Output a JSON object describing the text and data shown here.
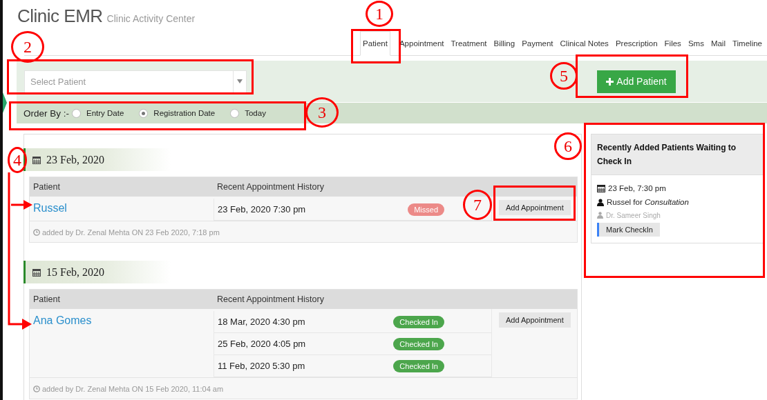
{
  "header": {
    "title": "Clinic EMR",
    "subtitle": "Clinic Activity Center"
  },
  "tabs": [
    {
      "label": "Patient",
      "selected": true
    },
    {
      "label": "Appointment",
      "selected": false
    },
    {
      "label": "Treatment",
      "selected": false
    },
    {
      "label": "Billing",
      "selected": false
    },
    {
      "label": "Payment",
      "selected": false
    },
    {
      "label": "Clinical Notes",
      "selected": false
    },
    {
      "label": "Prescription",
      "selected": false
    },
    {
      "label": "Files",
      "selected": false
    },
    {
      "label": "Sms",
      "selected": false
    },
    {
      "label": "Mail",
      "selected": false
    },
    {
      "label": "Timeline",
      "selected": false
    }
  ],
  "patient_select": {
    "placeholder": "Select Patient"
  },
  "add_patient_button": {
    "label": "Add Patient"
  },
  "order_by": {
    "label": "Order By :-",
    "options": [
      {
        "label": "Entry Date",
        "selected": false
      },
      {
        "label": "Registration Date",
        "selected": true
      },
      {
        "label": "Today",
        "selected": false
      }
    ]
  },
  "groups": [
    {
      "date": "23 Feb, 2020",
      "columns": [
        "Patient",
        "Recent Appointment History"
      ],
      "patient": "Russel",
      "appointments": [
        {
          "time": "23 Feb, 2020 7:30 pm",
          "status": "Missed",
          "kind": "missed"
        }
      ],
      "action": "Add Appointment",
      "added_by": "added by Dr. Zenal Mehta ON 23 Feb 2020, 7:18 pm"
    },
    {
      "date": "15 Feb, 2020",
      "columns": [
        "Patient",
        "Recent Appointment History"
      ],
      "patient": "Ana Gomes",
      "appointments": [
        {
          "time": "18 Mar, 2020 4:30 pm",
          "status": "Checked In",
          "kind": "checked_in"
        },
        {
          "time": "25 Feb, 2020 4:05 pm",
          "status": "Checked In",
          "kind": "checked_in"
        },
        {
          "time": "11 Feb, 2020 5:30 pm",
          "status": "Checked In",
          "kind": "checked_in"
        }
      ],
      "action": "Add Appointment",
      "added_by": "added by Dr. Zenal Mehta ON 15 Feb 2020, 11:04 am"
    }
  ],
  "waiting_panel": {
    "title": "Recently Added Patients Waiting to Check In",
    "entries": [
      {
        "time": "23 Feb, 7:30 pm",
        "visit": "Russel for *Consultation*",
        "doctor": "Dr. Sameer Singh",
        "action": "Mark CheckIn"
      }
    ]
  },
  "annotations": [
    {
      "number": "1",
      "kind": "box"
    },
    {
      "number": "2",
      "kind": "box"
    },
    {
      "number": "3",
      "kind": "box"
    },
    {
      "number": "4",
      "kind": "arrows"
    },
    {
      "number": "5",
      "kind": "box"
    },
    {
      "number": "6",
      "kind": "box"
    },
    {
      "number": "7",
      "kind": "box"
    }
  ]
}
